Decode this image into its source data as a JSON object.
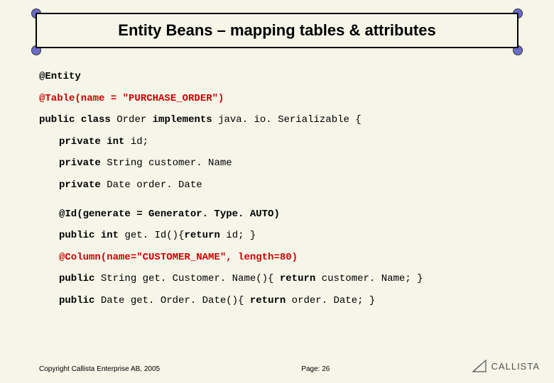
{
  "title": "Entity Beans – mapping tables & attributes",
  "code": {
    "l1a": "@Entity",
    "l2a": "@Table(name = \"PURCHASE_ORDER\")",
    "l3_kw1": "public",
    "l3_kw2": "class",
    "l3_mid": " Order ",
    "l3_kw3": "implements",
    "l3_end": " java. io. Serializable {",
    "l4_kw1": "private",
    "l4_kw2": "int",
    "l4_end": " id;",
    "l5_kw1": "private",
    "l5_end": " String customer. Name",
    "l6_kw1": "private",
    "l6_end": " Date order. Date",
    "l7a": "@Id(generate = Generator. Type. AUTO)",
    "l8_kw1": "public",
    "l8_kw2": "int",
    "l8_mid": " get. Id(){",
    "l8_ret": "return",
    "l8_end": " id; }",
    "l9a": "@Column(name=\"CUSTOMER_NAME\", length=80)",
    "l10_kw1": "public",
    "l10_mid": " String get. Customer. Name(){ ",
    "l10_ret": "return",
    "l10_end": " customer. Name; }",
    "l11_kw1": "public",
    "l11_mid": " Date get. Order. Date(){ ",
    "l11_ret": "return",
    "l11_end": " order. Date; }"
  },
  "footer": {
    "copyright": "Copyright Callista Enterprise AB, 2005",
    "page": "Page: 26",
    "logo": "CALLISTA"
  }
}
